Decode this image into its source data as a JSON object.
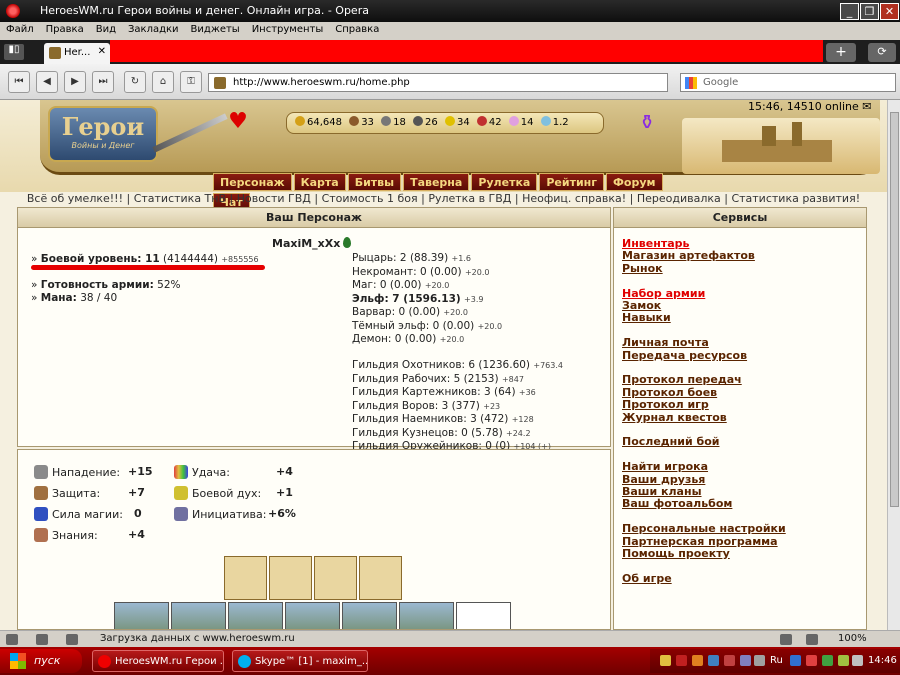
{
  "window": {
    "title": "HeroesWM.ru Герои войны и денег. Онлайн игра. - Opera",
    "min": "_",
    "max": "❐",
    "close": "✕"
  },
  "menu": [
    "Файл",
    "Правка",
    "Вид",
    "Закладки",
    "Виджеты",
    "Инструменты",
    "Справка"
  ],
  "tab": {
    "label": "Her...",
    "close": "✕"
  },
  "tabbar": {
    "new_tab": "+",
    "clock_icon": "⟳"
  },
  "address": {
    "url": "http://www.heroeswm.ru/home.php",
    "search_placeholder": "Google"
  },
  "header": {
    "online": "15:46, 14510 online",
    "logo_title": "Герои",
    "logo_subtitle": "Войны и Денег",
    "resources": [
      "64,648",
      "33",
      "18",
      "26",
      "34",
      "42",
      "14",
      "1.2"
    ],
    "resource_colors": [
      "#d4a017",
      "#8b5a2b",
      "#777777",
      "#555555",
      "#e0c000",
      "#c03030",
      "#e0a0e0",
      "#80c0e0"
    ]
  },
  "game_menu": [
    "Персонаж",
    "Карта",
    "Битвы",
    "Таверна",
    "Рулетка",
    "Рейтинг",
    "Форум",
    "Чат"
  ],
  "links_bar": "Всё об умелке!!! | Статистика ТнВ | Новости ГВД | Стоимость 1 боя | Рулетка в ГВД | Неофиц. справка! | Переодивалка | Статистика развития!",
  "character": {
    "header": "Ваш Персонаж",
    "nick": "MaxiM_xXx",
    "level_label": "Боевой уровень: 11",
    "level_exp": "(4144444)",
    "level_bonus": "+855556",
    "army_label": "Готовность армии:",
    "army_value": "52%",
    "mana_label": "Мана:",
    "mana_value": "38 / 40",
    "factions": [
      {
        "text": "Рыцарь: 2 (88.39)",
        "bonus": "+1.6"
      },
      {
        "text": "Некромант: 0 (0.00)",
        "bonus": "+20.0"
      },
      {
        "text": "Маг: 0 (0.00)",
        "bonus": "+20.0"
      },
      {
        "text": "Эльф: 7 (1596.13)",
        "bonus": "+3.9"
      },
      {
        "text": "Варвар: 0 (0.00)",
        "bonus": "+20.0"
      },
      {
        "text": "Тёмный эльф: 0 (0.00)",
        "bonus": "+20.0"
      },
      {
        "text": "Демон: 0 (0.00)",
        "bonus": "+20.0"
      }
    ],
    "guilds": [
      {
        "text": "Гильдия Охотников: 6 (1236.60)",
        "bonus": "+763.4"
      },
      {
        "text": "Гильдия Рабочих: 5 (2153)",
        "bonus": "+847"
      },
      {
        "text": "Гильдия Картежников: 3 (64)",
        "bonus": "+36"
      },
      {
        "text": "Гильдия Воров: 3 (377)",
        "bonus": "+23"
      },
      {
        "text": "Гильдия Наемников: 3 (472)",
        "bonus": "+128"
      },
      {
        "text": "Гильдия Кузнецов: 0 (5.78)",
        "bonus": "+24.2"
      },
      {
        "text": "Гильдия Оружейников: 0 (0)",
        "bonus": "+104 (+)"
      }
    ]
  },
  "attributes": {
    "left": [
      {
        "label": "Нападение:",
        "value": "+15",
        "color": "#8a8a8a"
      },
      {
        "label": "Защита:",
        "value": "+7",
        "color": "#a07040"
      },
      {
        "label": "Сила магии:",
        "value": "0",
        "color": "#3050c0"
      },
      {
        "label": "Знания:",
        "value": "+4",
        "color": "#b07050"
      }
    ],
    "right": [
      {
        "label": "Удача:",
        "value": "+4",
        "color": "#e06060"
      },
      {
        "label": "Боевой дух:",
        "value": "+1",
        "color": "#d0c030"
      },
      {
        "label": "Инициатива:",
        "value": "+6%",
        "color": "#7070a0"
      }
    ]
  },
  "services": {
    "header": "Сервисы",
    "groups": [
      [
        {
          "label": "Инвентарь",
          "red": true
        },
        {
          "label": "Магазин артефактов"
        },
        {
          "label": "Рынок"
        }
      ],
      [
        {
          "label": "Набор армии",
          "red": true
        },
        {
          "label": "Замок"
        },
        {
          "label": "Навыки"
        }
      ],
      [
        {
          "label": "Личная почта"
        },
        {
          "label": "Передача ресурсов"
        }
      ],
      [
        {
          "label": "Протокол передач"
        },
        {
          "label": "Протокол боев"
        },
        {
          "label": "Протокол игр"
        },
        {
          "label": "Журнал квестов"
        }
      ],
      [
        {
          "label": "Последний бой"
        }
      ],
      [
        {
          "label": "Найти игрока"
        },
        {
          "label": "Ваши друзья"
        },
        {
          "label": "Ваши кланы"
        },
        {
          "label": "Ваш фотоальбом"
        }
      ],
      [
        {
          "label": "Персональные настройки"
        },
        {
          "label": "Партнерская программа"
        },
        {
          "label": "Помощь проекту"
        }
      ],
      [
        {
          "label": "Об игре"
        }
      ]
    ]
  },
  "status": {
    "text": "Загрузка данных с www.heroeswm.ru",
    "zoom": "100%"
  },
  "taskbar": {
    "start": "пуск",
    "items": [
      "HeroesWM.ru Герои ...",
      "Skype™ [1] - maxim_..."
    ],
    "lang": "Ru",
    "clock": "14:46"
  }
}
